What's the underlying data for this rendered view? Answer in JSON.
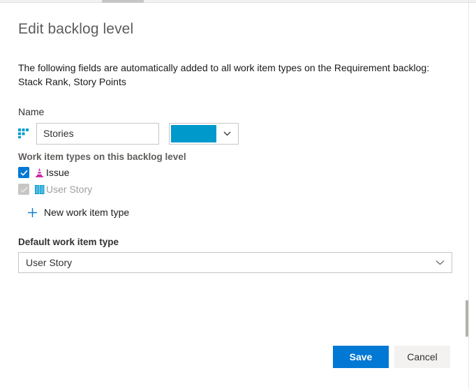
{
  "window": {
    "title": "Edit backlog level"
  },
  "dialog": {
    "title": "Edit backlog level",
    "description": "The following fields are automatically added to all work item types on the Requirement backlog: Stack Rank, Story Points"
  },
  "name_field": {
    "label": "Name",
    "value": "Stories",
    "placeholder": "Name",
    "icon": "backlog-level-icon",
    "color": "#0099cc",
    "color_caret_icon": "chevron-down-icon"
  },
  "work_item_types": {
    "label": "Work item types on this backlog level",
    "items": [
      {
        "name": "Issue",
        "checked": true,
        "disabled": false,
        "icon": "issue-cone-icon",
        "icon_color": "#cc293d"
      },
      {
        "name": "User Story",
        "checked": true,
        "disabled": true,
        "icon": "user-story-book-icon",
        "icon_color": "#009ccc"
      }
    ],
    "add_label": "New work item type",
    "add_icon": "plus-icon"
  },
  "default_type": {
    "label": "Default work item type",
    "value": "User Story",
    "caret_icon": "chevron-down-icon"
  },
  "footer": {
    "save_label": "Save",
    "cancel_label": "Cancel"
  },
  "theme": {
    "accent": "#0078d4",
    "swatch": "#0099cc",
    "issue_magenta": "#cc293d",
    "story_blue": "#009ccc",
    "border": "#c8c6c4",
    "title_gray": "#5c5c5c"
  }
}
